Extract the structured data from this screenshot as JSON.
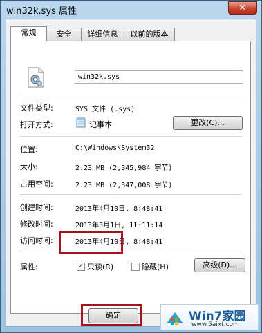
{
  "window": {
    "title": "win32k.sys 属性",
    "close_glyph": "✕"
  },
  "tabs": [
    "常规",
    "安全",
    "详细信息",
    "以前的版本"
  ],
  "file": {
    "name": "win32k.sys"
  },
  "props": {
    "type_label": "文件类型:",
    "type_value": "SYS 文件 (.sys)",
    "open_label": "打开方式:",
    "open_value": "记事本",
    "change_button": "更改(C)...",
    "location_label": "位置:",
    "location_value": "C:\\Windows\\System32",
    "size_label": "大小:",
    "size_value": "2.23 MB (2,345,984 字节)",
    "disk_label": "占用空间:",
    "disk_value": "2.23 MB (2,347,008 字节)",
    "created_label": "创建时间:",
    "created_value": "2013年4月10日, 8:48:41",
    "modified_label": "修改时间:",
    "modified_value": "2013年3月1日, 11:11:14",
    "accessed_label": "访问时间:",
    "accessed_value": "2013年4月10日, 8:48:41",
    "attr_label": "属性:",
    "readonly_label": "只读(R)",
    "hidden_label": "隐藏(H)",
    "advanced_button": "高级(D)..."
  },
  "buttons": {
    "ok": "确定"
  },
  "watermark": {
    "brand": "Win7家园",
    "url": "www.5aixt.com"
  }
}
